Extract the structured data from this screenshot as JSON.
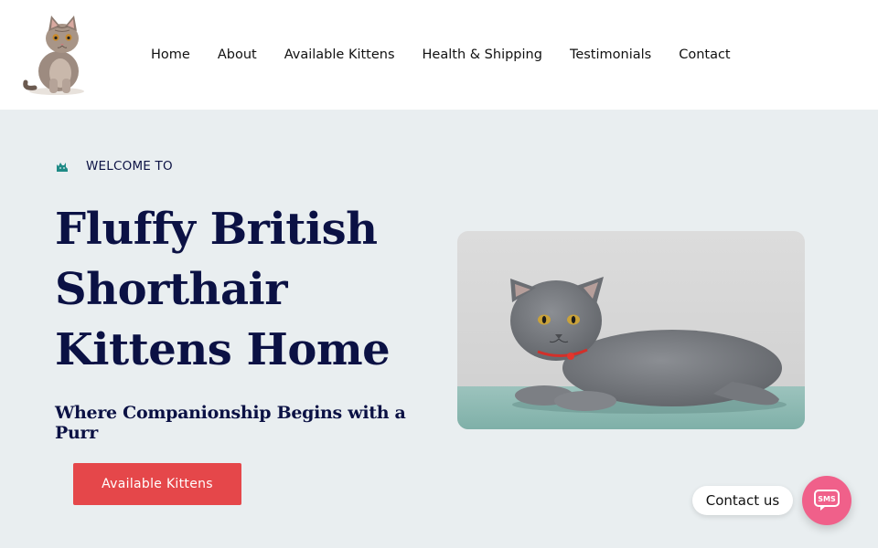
{
  "header": {
    "logo_icon": "kitten-logo",
    "nav": [
      {
        "label": "Home"
      },
      {
        "label": "About"
      },
      {
        "label": "Available Kittens"
      },
      {
        "label": "Health & Shipping"
      },
      {
        "label": "Testimonials"
      },
      {
        "label": "Contact"
      }
    ]
  },
  "hero": {
    "welcome_icon": "cat-icon",
    "welcome_text": "WELCOME TO",
    "title": "Fluffy British Shorthair Kittens Home",
    "subtitle": "Where Companionship Begins with a Purr",
    "cta_label": "Available Kittens",
    "image_icon": "grey-cat-photo"
  },
  "chat_widget": {
    "label": "Contact us",
    "icon": "sms-icon",
    "icon_text": "SMS"
  },
  "colors": {
    "header_bg": "#ffffff",
    "hero_bg": "#e9eef0",
    "title": "#0b1144",
    "cta": "#e5474a",
    "accent_teal": "#1f8a86",
    "sms": "#f0608a"
  }
}
